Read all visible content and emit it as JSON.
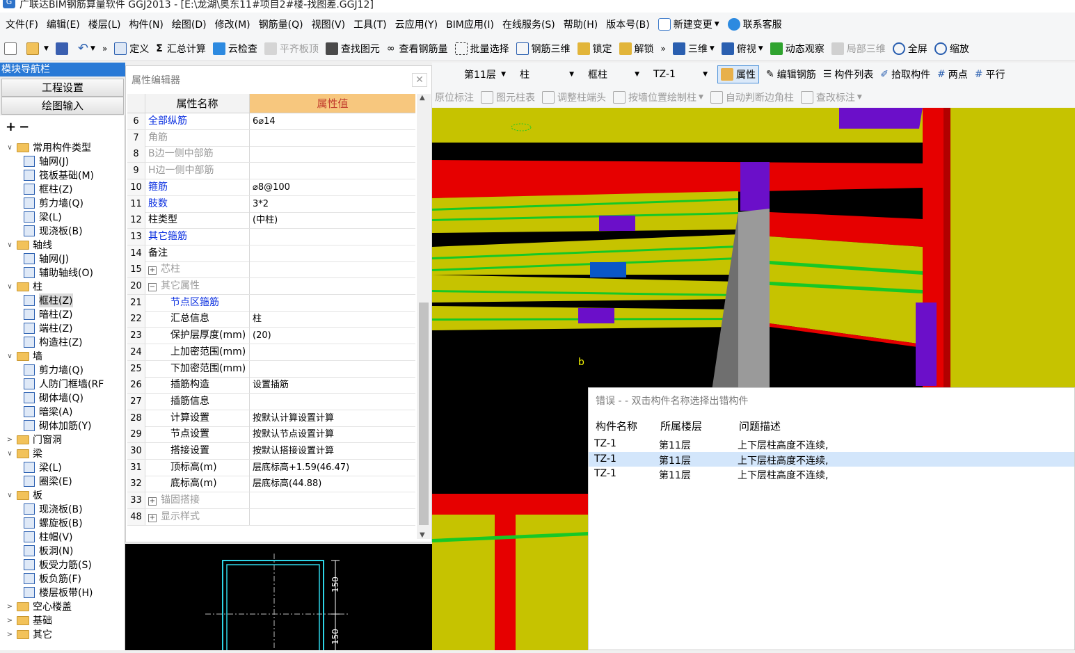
{
  "window": {
    "title": "广联达BIM钢筋算量软件 GGJ2013 - [E:\\龙湖\\奥东11#项目2#楼-找图差.GGJ12]"
  },
  "menu": {
    "items": [
      "文件(F)",
      "编辑(E)",
      "楼层(L)",
      "构件(N)",
      "绘图(D)",
      "修改(M)",
      "钢筋量(Q)",
      "视图(V)",
      "工具(T)",
      "云应用(Y)",
      "BIM应用(I)",
      "在线服务(S)",
      "帮助(H)",
      "版本号(B)"
    ],
    "new_change": "新建变更",
    "contact": "联系客服"
  },
  "toolbar1": {
    "define": "定义",
    "sum_calc": "汇总计算",
    "cloud_check": "云检查",
    "flat_slab_top": "平齐板顶",
    "find_element": "查找图元",
    "view_rebar": "查看钢筋量",
    "batch_select": "批量选择",
    "rebar_3d": "钢筋三维",
    "lock": "锁定",
    "unlock": "解锁",
    "three_d": "三维",
    "top_view": "俯视",
    "dynamic_view": "动态观察",
    "local_3d": "局部三维",
    "fullscreen": "全屏",
    "zoom": "缩放"
  },
  "navigator": {
    "title": "模块导航栏",
    "project_settings": "工程设置",
    "drawing_input": "绘图输入",
    "tree": [
      {
        "label": "常用构件类型",
        "level": 0,
        "folder": true,
        "open": true
      },
      {
        "label": "轴网(J)",
        "level": 1
      },
      {
        "label": "筏板基础(M)",
        "level": 1
      },
      {
        "label": "框柱(Z)",
        "level": 1
      },
      {
        "label": "剪力墙(Q)",
        "level": 1
      },
      {
        "label": "梁(L)",
        "level": 1
      },
      {
        "label": "现浇板(B)",
        "level": 1
      },
      {
        "label": "轴线",
        "level": 0,
        "folder": true,
        "open": true
      },
      {
        "label": "轴网(J)",
        "level": 1
      },
      {
        "label": "辅助轴线(O)",
        "level": 1
      },
      {
        "label": "柱",
        "level": 0,
        "folder": true,
        "open": true
      },
      {
        "label": "框柱(Z)",
        "level": 1,
        "selected": true
      },
      {
        "label": "暗柱(Z)",
        "level": 1
      },
      {
        "label": "端柱(Z)",
        "level": 1
      },
      {
        "label": "构造柱(Z)",
        "level": 1
      },
      {
        "label": "墙",
        "level": 0,
        "folder": true,
        "open": true
      },
      {
        "label": "剪力墙(Q)",
        "level": 1
      },
      {
        "label": "人防门框墙(RF",
        "level": 1
      },
      {
        "label": "砌体墙(Q)",
        "level": 1
      },
      {
        "label": "暗梁(A)",
        "level": 1
      },
      {
        "label": "砌体加筋(Y)",
        "level": 1
      },
      {
        "label": "门窗洞",
        "level": 0,
        "folder": true,
        "open": false
      },
      {
        "label": "梁",
        "level": 0,
        "folder": true,
        "open": true
      },
      {
        "label": "梁(L)",
        "level": 1
      },
      {
        "label": "圈梁(E)",
        "level": 1
      },
      {
        "label": "板",
        "level": 0,
        "folder": true,
        "open": true
      },
      {
        "label": "现浇板(B)",
        "level": 1
      },
      {
        "label": "螺旋板(B)",
        "level": 1
      },
      {
        "label": "柱帽(V)",
        "level": 1
      },
      {
        "label": "板洞(N)",
        "level": 1
      },
      {
        "label": "板受力筋(S)",
        "level": 1
      },
      {
        "label": "板负筋(F)",
        "level": 1
      },
      {
        "label": "楼层板带(H)",
        "level": 1
      },
      {
        "label": "空心楼盖",
        "level": 0,
        "folder": true,
        "open": false
      },
      {
        "label": "基础",
        "level": 0,
        "folder": true,
        "open": false
      },
      {
        "label": "其它",
        "level": 0,
        "folder": true,
        "open": false
      }
    ]
  },
  "property_editor": {
    "title": "属性编辑器",
    "col_name": "属性名称",
    "col_value": "属性值",
    "rows": [
      {
        "num": "6",
        "name": "全部纵筋",
        "value": "6⌀14",
        "style": "blue"
      },
      {
        "num": "7",
        "name": "角筋",
        "value": "",
        "style": "gray"
      },
      {
        "num": "8",
        "name": "B边一侧中部筋",
        "value": "",
        "style": "gray"
      },
      {
        "num": "9",
        "name": "H边一侧中部筋",
        "value": "",
        "style": "gray"
      },
      {
        "num": "10",
        "name": "箍筋",
        "value": "⌀8@100",
        "style": "blue"
      },
      {
        "num": "11",
        "name": "肢数",
        "value": "3*2",
        "style": "blue"
      },
      {
        "num": "12",
        "name": "柱类型",
        "value": "(中柱)",
        "style": "normal"
      },
      {
        "num": "13",
        "name": "其它箍筋",
        "value": "",
        "style": "blue"
      },
      {
        "num": "14",
        "name": "备注",
        "value": "",
        "style": "normal"
      },
      {
        "num": "15",
        "name": "芯柱",
        "value": "",
        "style": "gray",
        "expand": "+"
      },
      {
        "num": "20",
        "name": "其它属性",
        "value": "",
        "style": "gray",
        "expand": "−"
      },
      {
        "num": "21",
        "name": "节点区箍筋",
        "value": "",
        "style": "blue",
        "indent": true
      },
      {
        "num": "22",
        "name": "汇总信息",
        "value": "柱",
        "style": "normal",
        "indent": true
      },
      {
        "num": "23",
        "name": "保护层厚度(mm)",
        "value": "(20)",
        "style": "normal",
        "indent": true
      },
      {
        "num": "24",
        "name": "上加密范围(mm)",
        "value": "",
        "style": "normal",
        "indent": true
      },
      {
        "num": "25",
        "name": "下加密范围(mm)",
        "value": "",
        "style": "normal",
        "indent": true
      },
      {
        "num": "26",
        "name": "插筋构造",
        "value": "设置插筋",
        "style": "normal",
        "indent": true
      },
      {
        "num": "27",
        "name": "插筋信息",
        "value": "",
        "style": "normal",
        "indent": true
      },
      {
        "num": "28",
        "name": "计算设置",
        "value": "按默认计算设置计算",
        "style": "normal",
        "indent": true
      },
      {
        "num": "29",
        "name": "节点设置",
        "value": "按默认节点设置计算",
        "style": "normal",
        "indent": true
      },
      {
        "num": "30",
        "name": "搭接设置",
        "value": "按默认搭接设置计算",
        "style": "normal",
        "indent": true
      },
      {
        "num": "31",
        "name": "顶标高(m)",
        "value": "层底标高+1.59(46.47)",
        "style": "normal",
        "indent": true
      },
      {
        "num": "32",
        "name": "底标高(m)",
        "value": "层底标高(44.88)",
        "style": "normal",
        "indent": true
      },
      {
        "num": "33",
        "name": "锚固搭接",
        "value": "",
        "style": "gray",
        "expand": "+"
      },
      {
        "num": "48",
        "name": "显示样式",
        "value": "",
        "style": "gray",
        "expand": "+"
      }
    ]
  },
  "section_preview": {
    "dim_top": "150",
    "dim_bottom": "150"
  },
  "toolbar2": {
    "floor": "第11层",
    "category": "柱",
    "type": "框柱",
    "element": "TZ-1",
    "property": "属性",
    "edit_rebar": "编辑钢筋",
    "element_list": "构件列表",
    "pick_element": "拾取构件",
    "two_points": "两点",
    "parallel": "平行"
  },
  "toolbar3": {
    "original_mark": "原位标注",
    "column_table": "图元柱表",
    "adjust_column_end": "调整柱端头",
    "draw_by_wall": "按墙位置绘制柱",
    "auto_corner": "自动判断边角柱",
    "check_mark": "查改标注"
  },
  "viewport": {
    "marker": "b"
  },
  "error_panel": {
    "title": "错误 - - 双击构件名称选择出错构件",
    "headers": [
      "构件名称",
      "所属楼层",
      "问题描述"
    ],
    "rows": [
      [
        "TZ-1",
        "第11层",
        "上下层柱高度不连续,"
      ],
      [
        "TZ-1",
        "第11层",
        "上下层柱高度不连续,"
      ],
      [
        "TZ-1",
        "第11层",
        "上下层柱高度不连续,"
      ]
    ],
    "selected_row": 1
  },
  "colors": {
    "beam_yellow": "#c6c300",
    "column_red": "#e60000",
    "purple": "#6b0fc9",
    "blue": "#0a57c8",
    "green": "#17c826",
    "gray_column": "#9a9a9a",
    "nav_blue": "#2979d6",
    "header_orange": "#f7c77e"
  }
}
